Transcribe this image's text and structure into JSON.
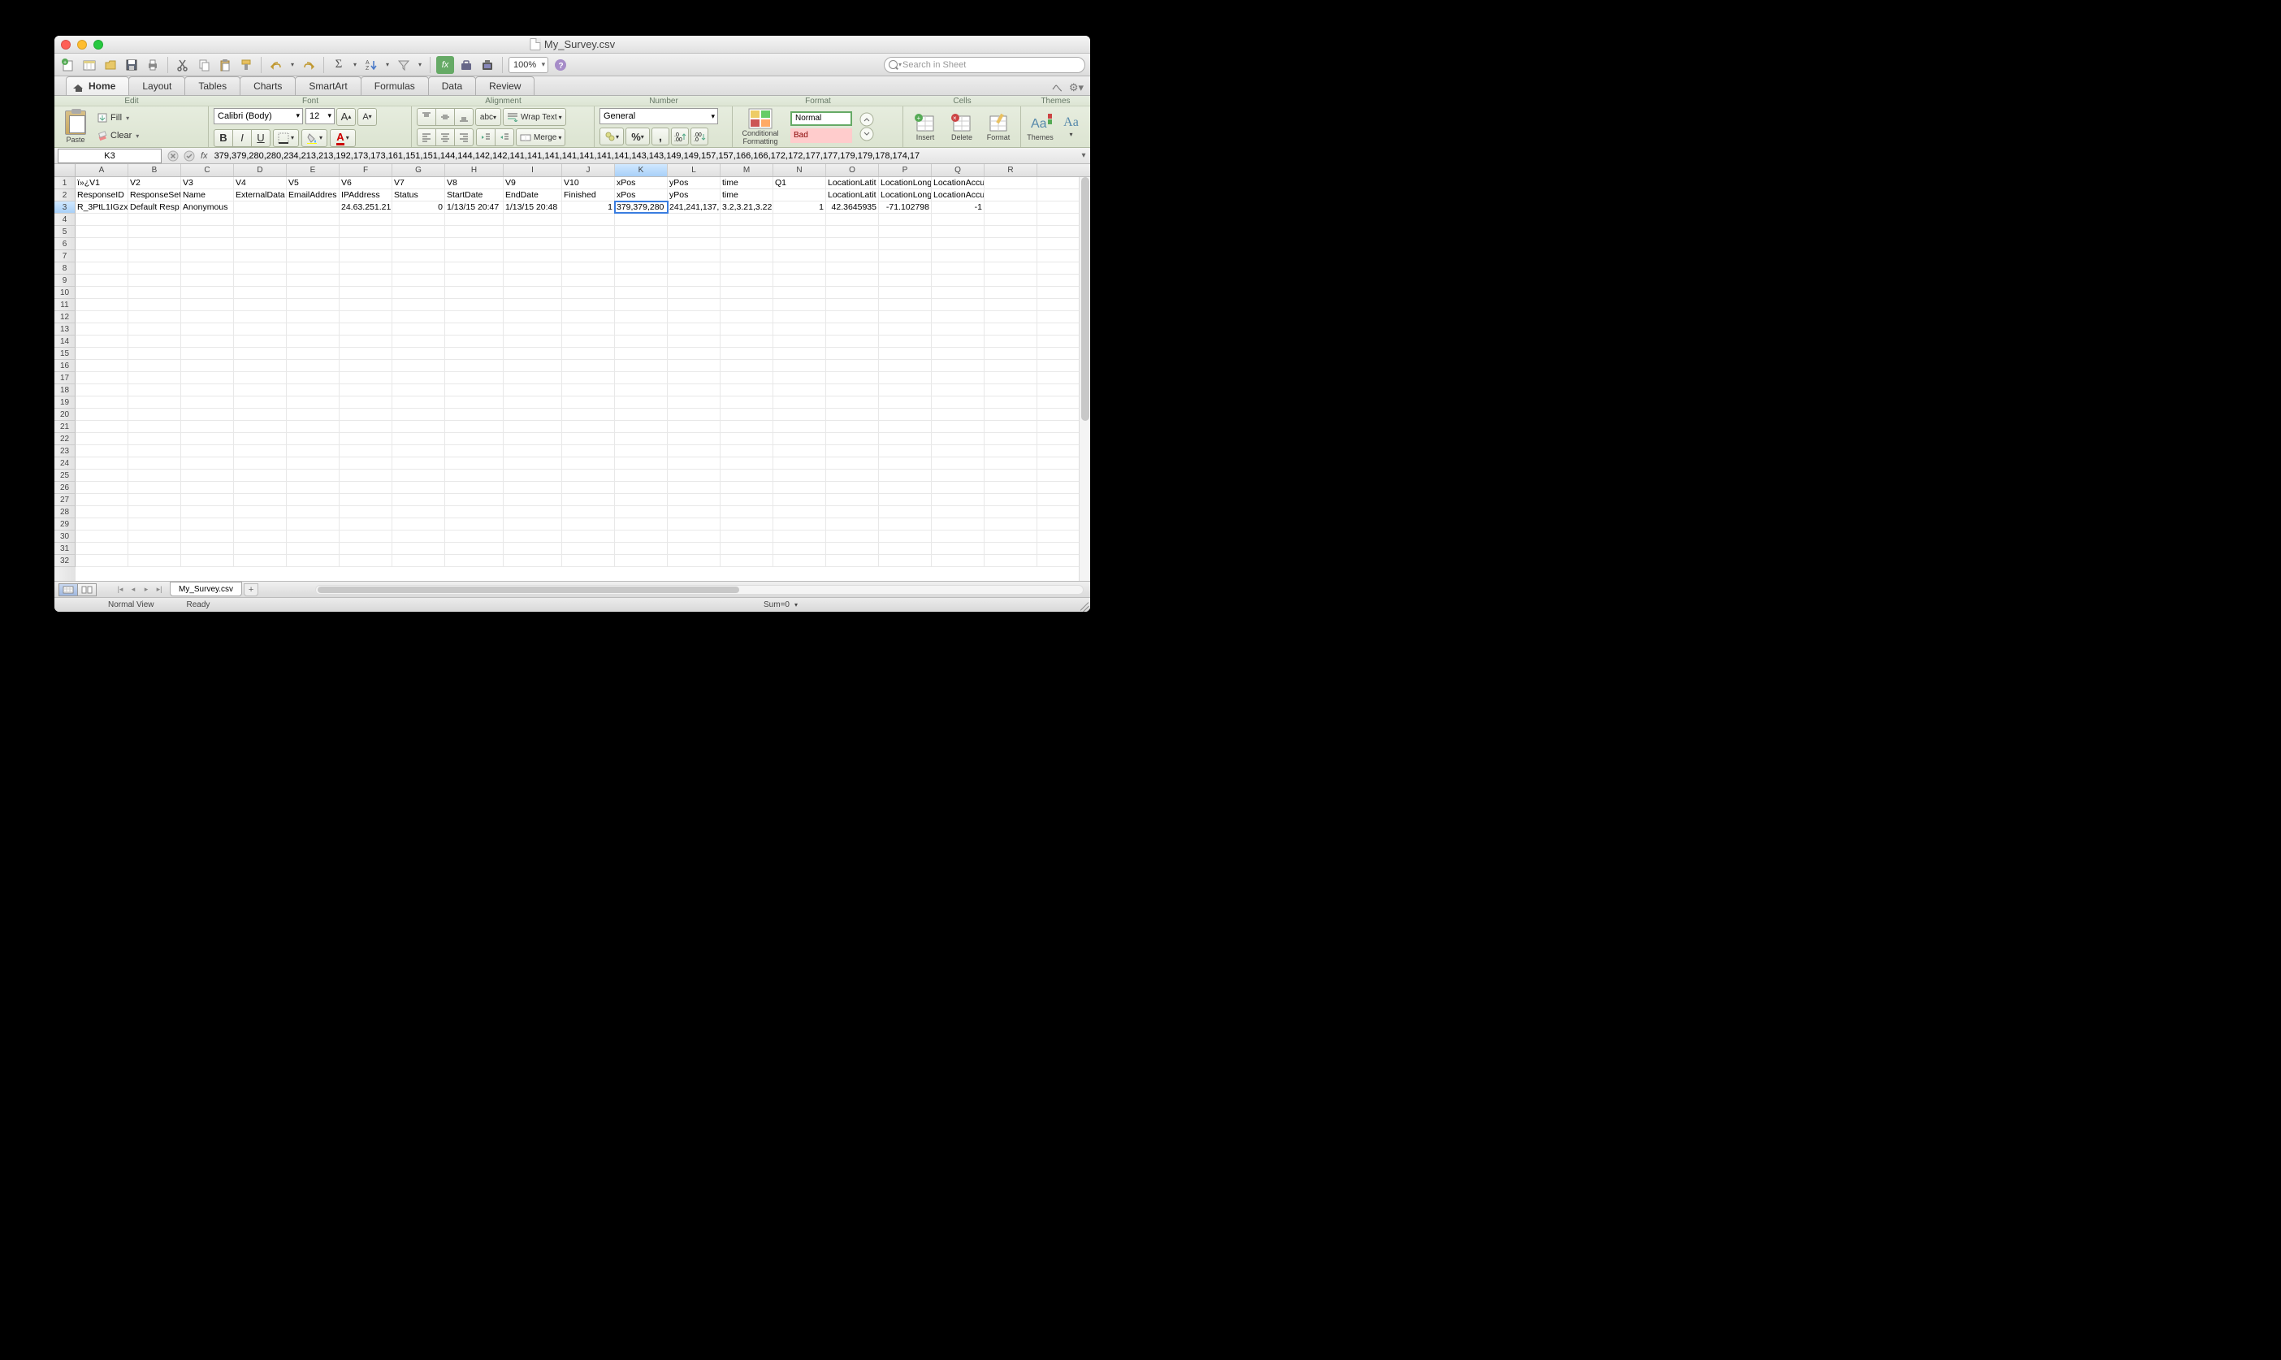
{
  "window": {
    "title": "My_Survey.csv"
  },
  "toolbar": {
    "zoom": "100%",
    "searchPlaceholder": "Search in Sheet"
  },
  "tabs": [
    "Home",
    "Layout",
    "Tables",
    "Charts",
    "SmartArt",
    "Formulas",
    "Data",
    "Review"
  ],
  "ribbon": {
    "groups": [
      "Edit",
      "Font",
      "Alignment",
      "Number",
      "Format",
      "Cells",
      "Themes"
    ],
    "paste": "Paste",
    "fill": "Fill",
    "clear": "Clear",
    "fontName": "Calibri (Body)",
    "fontSize": "12",
    "wrapText": "Wrap Text",
    "merge": "Merge",
    "numberFormat": "General",
    "condFmt": "Conditional\nFormatting",
    "styleNormal": "Normal",
    "styleBad": "Bad",
    "insert": "Insert",
    "delete": "Delete",
    "format": "Format",
    "themes": "Themes",
    "aa": "Aa"
  },
  "formulaBar": {
    "cellRef": "K3",
    "formula": "379,379,280,280,234,213,213,192,173,173,161,151,151,144,144,142,142,141,141,141,141,141,141,141,143,143,149,149,157,157,166,166,172,172,177,177,179,179,178,174,17"
  },
  "columns": [
    "A",
    "B",
    "C",
    "D",
    "E",
    "F",
    "G",
    "H",
    "I",
    "J",
    "K",
    "L",
    "M",
    "N",
    "O",
    "P",
    "Q",
    "R"
  ],
  "selectedCol": "K",
  "selectedRow": 3,
  "rowCount": 32,
  "data": {
    "row1": [
      "ï»¿V1",
      "V2",
      "V3",
      "V4",
      "V5",
      "V6",
      "V7",
      "V8",
      "V9",
      "V10",
      "xPos",
      "yPos",
      "time",
      "Q1",
      "LocationLatit",
      "LocationLong",
      "LocationAccuracy",
      ""
    ],
    "row2": [
      "ResponseID",
      "ResponseSet",
      "Name",
      "ExternalData",
      "EmailAddres",
      "IPAddress",
      "Status",
      "StartDate",
      "EndDate",
      "Finished",
      "xPos",
      "yPos",
      "time",
      "",
      "LocationLatit",
      "LocationLong",
      "LocationAccuracy",
      ""
    ],
    "row3": [
      "R_3PtL1IGzx",
      "Default Resp",
      "Anonymous",
      "",
      "",
      "24.63.251.21",
      "0",
      "1/13/15 20:47",
      "1/13/15 20:48",
      "1",
      "379,379,280",
      "241,241,137,",
      "3.2,3.21,3.22",
      "1",
      "42.3645935",
      "-71.102798",
      "-1",
      ""
    ]
  },
  "rightAlign": {
    "row3": {
      "6": true,
      "9": true,
      "13": true,
      "14": true,
      "15": true,
      "16": true
    }
  },
  "sheet": {
    "name": "My_Survey.csv"
  },
  "status": {
    "view": "Normal View",
    "state": "Ready",
    "sum": "Sum=0"
  }
}
